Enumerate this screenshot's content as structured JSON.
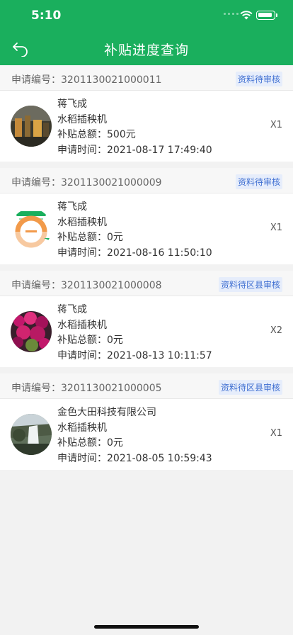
{
  "status": {
    "time": "5:10"
  },
  "nav": {
    "title": "补贴进度查询"
  },
  "records": [
    {
      "app_no": "申请编号：3201130021000011",
      "status": "资料待审核",
      "name": "蒋飞成",
      "machine": "水稻插秧机",
      "subsidy": "补贴总额：500元",
      "time": "申请时间：2021-08-17 17:49:40",
      "qty": "X1"
    },
    {
      "app_no": "申请编号：3201130021000009",
      "status": "资料待审核",
      "name": "蒋飞成",
      "machine": "水稻插秧机",
      "subsidy": "补贴总额：0元",
      "time": "申请时间：2021-08-16 11:50:10",
      "qty": "X1"
    },
    {
      "app_no": "申请编号：3201130021000008",
      "status": "资料待区县审核",
      "name": "蒋飞成",
      "machine": "水稻插秧机",
      "subsidy": "补贴总额：0元",
      "time": "申请时间：2021-08-13 10:11:57",
      "qty": "X2"
    },
    {
      "app_no": "申请编号：3201130021000005",
      "status": "资料待区县审核",
      "name": "金色大田科技有限公司",
      "machine": "水稻插秧机",
      "subsidy": "补贴总额：0元",
      "time": "申请时间：2021-08-05 10:59:43",
      "qty": "X1"
    }
  ],
  "colors": {
    "header": "#1aaf5d",
    "badge_text": "#3e6ed1",
    "badge_bg": "#e6edfb"
  },
  "icons": {
    "back": "back-arrow-icon",
    "wifi": "wifi-icon",
    "battery": "battery-icon",
    "signal": "signal-icon"
  }
}
